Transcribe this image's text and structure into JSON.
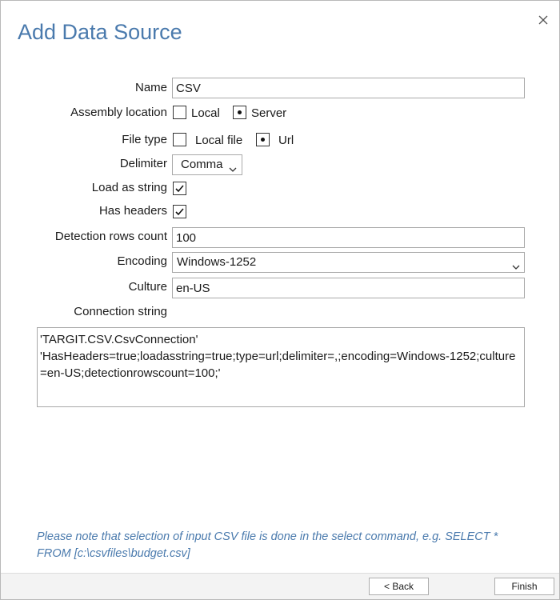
{
  "dialog": {
    "title": "Add Data Source",
    "close_icon": "close-icon"
  },
  "form": {
    "name": {
      "label": "Name",
      "value": "CSV"
    },
    "assembly_location": {
      "label": "Assembly location",
      "options": [
        {
          "label": "Local",
          "selected": false
        },
        {
          "label": "Server",
          "selected": true
        }
      ]
    },
    "file_type": {
      "label": "File type",
      "options": [
        {
          "label": "Local file",
          "selected": false
        },
        {
          "label": "Url",
          "selected": true
        }
      ]
    },
    "delimiter": {
      "label": "Delimiter",
      "value": "Comma"
    },
    "load_as_string": {
      "label": "Load as string",
      "checked": true
    },
    "has_headers": {
      "label": "Has headers",
      "checked": true
    },
    "detection_rows_count": {
      "label": "Detection rows count",
      "value": "100"
    },
    "encoding": {
      "label": "Encoding",
      "value": "Windows-1252"
    },
    "culture": {
      "label": "Culture",
      "value": "en-US"
    },
    "connection_string": {
      "label": "Connection string",
      "line1": "'TARGIT.CSV.CsvConnection'",
      "line2": "'HasHeaders=true;loadasstring=true;type=url;delimiter=,;encoding=Windows-1252;culture=en-US;detectionrowscount=100;'"
    }
  },
  "note": "Please note that selection of input CSV file is done in the select command, e.g. SELECT * FROM [c:\\csvfiles\\budget.csv]",
  "footer": {
    "back_label": "< Back",
    "finish_label": "Finish"
  },
  "colors": {
    "accent": "#4a7aad",
    "border": "#a9a9a9"
  }
}
